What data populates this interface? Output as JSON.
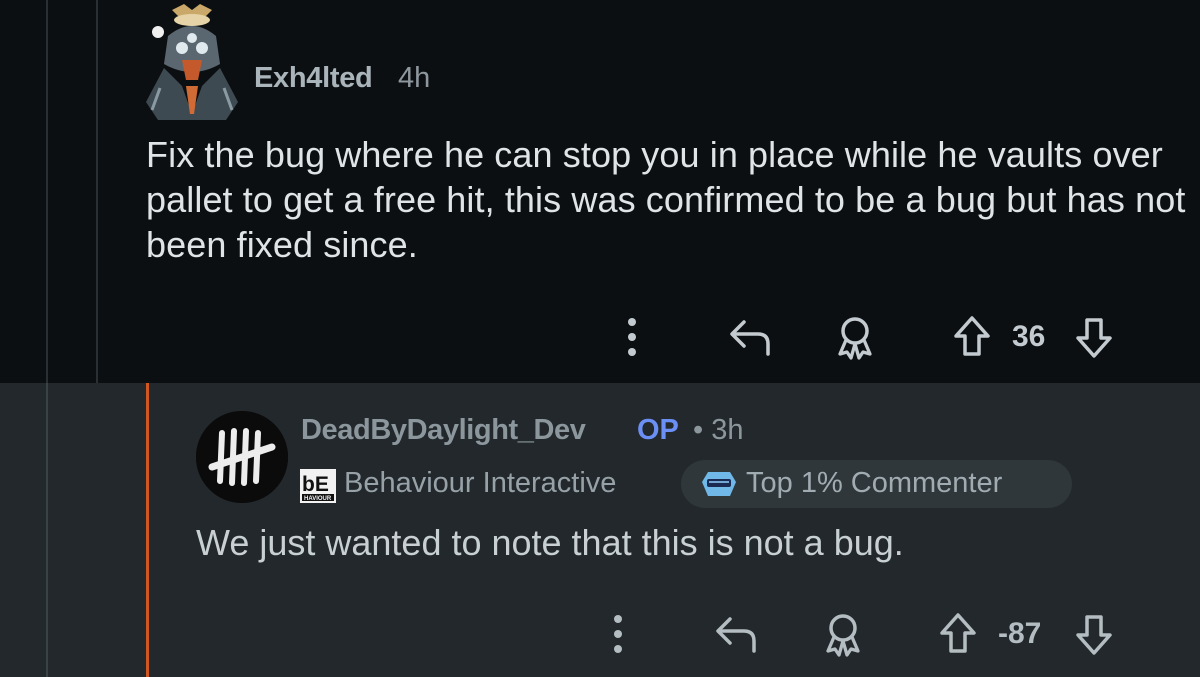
{
  "comment1": {
    "username": "Exh4lted",
    "time": "4h",
    "body": "Fix the bug where he can stop you in place while he vaults over pallet to get a free hit, this was confirmed to be a bug but has not been fixed since.",
    "votes": "36"
  },
  "comment2": {
    "username": "DeadByDaylight_Dev",
    "op_badge": "OP",
    "separator_time": "• 3h",
    "flair_logo_text": "bE",
    "flair_logo_subtext": "HAVIOUR",
    "flair": "Behaviour Interactive",
    "commenter_badge": "Top 1% Commenter",
    "body": "We just wanted to note that this is not a bug.",
    "votes": "-87"
  },
  "icons": [
    "more-options-icon",
    "reply-icon",
    "award-icon",
    "upvote-icon",
    "downvote-icon"
  ],
  "colors": {
    "op": "#6c8ff5",
    "thread_highlight": "#d2561f",
    "background_top": "#0c0f11",
    "background_reply": "#22282b"
  }
}
